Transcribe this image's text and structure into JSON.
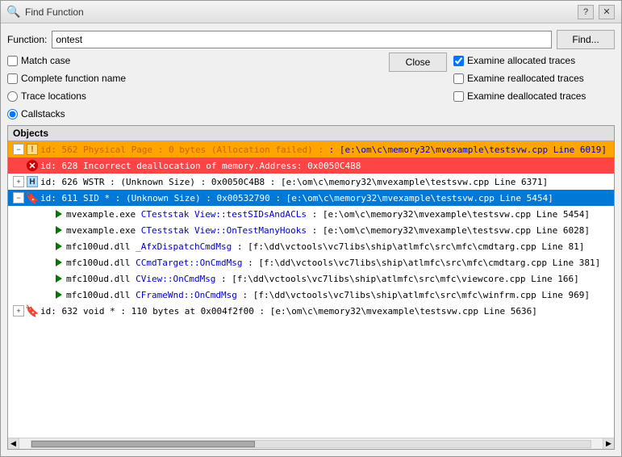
{
  "title": "Find Function",
  "function_label": "Function:",
  "function_value": "ontest",
  "find_button": "Find...",
  "close_button": "Close",
  "options": {
    "match_case": {
      "label": "Match case",
      "checked": false
    },
    "complete_function": {
      "label": "Complete function name",
      "checked": false
    },
    "trace_locations": {
      "label": "Trace locations",
      "checked": false,
      "radio": true,
      "selected": false
    },
    "callstacks": {
      "label": "Callstacks",
      "checked": true,
      "radio": true,
      "selected": true
    }
  },
  "right_options": {
    "examine_allocated": {
      "label": "Examine allocated traces",
      "checked": true
    },
    "examine_reallocated": {
      "label": "Examine reallocated traces",
      "checked": false
    },
    "examine_deallocated": {
      "label": "Examine deallocated traces",
      "checked": false
    }
  },
  "objects_header": "Objects",
  "rows": [
    {
      "id": "row1",
      "indent": 0,
      "expandable": true,
      "expanded": true,
      "bg": "orange",
      "icon_type": "alloc-fail",
      "text": "id: 562 Physical Page : 0 bytes (Allocation failed) : : [e:\\om\\c\\memory32\\mvexample\\testsvw.cpp Line 6019]",
      "text_color": "black"
    },
    {
      "id": "row2",
      "indent": 0,
      "expandable": false,
      "expanded": false,
      "bg": "red",
      "icon_type": "dealloc-err",
      "text": "id: 628 Incorrect deallocation of memory.Address: 0x0050C4B8",
      "text_color": "white"
    },
    {
      "id": "row3",
      "indent": 0,
      "expandable": true,
      "expanded": false,
      "bg": "normal",
      "icon_type": "H",
      "text": "id: 626 WSTR : (Unknown Size) : 0x0050C4B8 : [e:\\om\\c\\memory32\\mvexample\\testsvw.cpp Line 6371]",
      "text_color": "black"
    },
    {
      "id": "row4",
      "indent": 0,
      "expandable": true,
      "expanded": true,
      "bg": "selected",
      "icon_type": "bookmark",
      "text": "id: 611 SID * : (Unknown Size) : 0x00532790 : [e:\\om\\c\\memory32\\mvexample\\testsvw.cpp Line 5454]",
      "text_color": "white"
    },
    {
      "id": "row5",
      "indent": 1,
      "expandable": false,
      "expanded": false,
      "bg": "normal",
      "icon_type": "play",
      "text": "mvexample.exe CTeststak View::testSIDsAndACLs : [e:\\om\\c\\memory32\\mvexample\\testsvw.cpp Line 5454]",
      "text_color": "black"
    },
    {
      "id": "row6",
      "indent": 1,
      "expandable": false,
      "expanded": false,
      "bg": "normal",
      "icon_type": "play",
      "text": "mvexample.exe CTeststak View::OnTestManyHooks : [e:\\om\\c\\memory32\\mvexample\\testsvw.cpp Line 6028]",
      "text_color": "black"
    },
    {
      "id": "row7",
      "indent": 1,
      "expandable": false,
      "expanded": false,
      "bg": "normal",
      "icon_type": "play",
      "text": "mfc100ud.dll _AfxDispatchCmdMsg : [f:\\dd\\vctools\\vc7libs\\ship\\atlmfc\\src\\mfc\\cmdtarg.cpp Line 81]",
      "text_color": "black"
    },
    {
      "id": "row8",
      "indent": 1,
      "expandable": false,
      "expanded": false,
      "bg": "normal",
      "icon_type": "play",
      "text": "mfc100ud.dll CCmdTarget::OnCmdMsg : [f:\\dd\\vctools\\vc7libs\\ship\\atlmfc\\src\\mfc\\cmdtarg.cpp Line 381]",
      "text_color": "black"
    },
    {
      "id": "row9",
      "indent": 1,
      "expandable": false,
      "expanded": false,
      "bg": "normal",
      "icon_type": "play",
      "text": "mfc100ud.dll CView::OnCmdMsg : [f:\\dd\\vctools\\vc7libs\\ship\\atlmfc\\src\\mfc\\viewcore.cpp Line 166]",
      "text_color": "black"
    },
    {
      "id": "row10",
      "indent": 1,
      "expandable": false,
      "expanded": false,
      "bg": "normal",
      "icon_type": "play",
      "text": "mfc100ud.dll CFrameWnd::OnCmdMsg : [f:\\dd\\vctools\\vc7libs\\ship\\atlmfc\\src\\mfc\\winfrm.cpp Line 969]",
      "text_color": "black"
    },
    {
      "id": "row11",
      "indent": 0,
      "expandable": true,
      "expanded": false,
      "bg": "normal",
      "icon_type": "bookmark",
      "text": "id: 632 void * : 110 bytes at 0x004f2f00 : [e:\\om\\c\\memory32\\mvexample\\testsvw.cpp Line 5636]",
      "text_color": "black"
    }
  ]
}
